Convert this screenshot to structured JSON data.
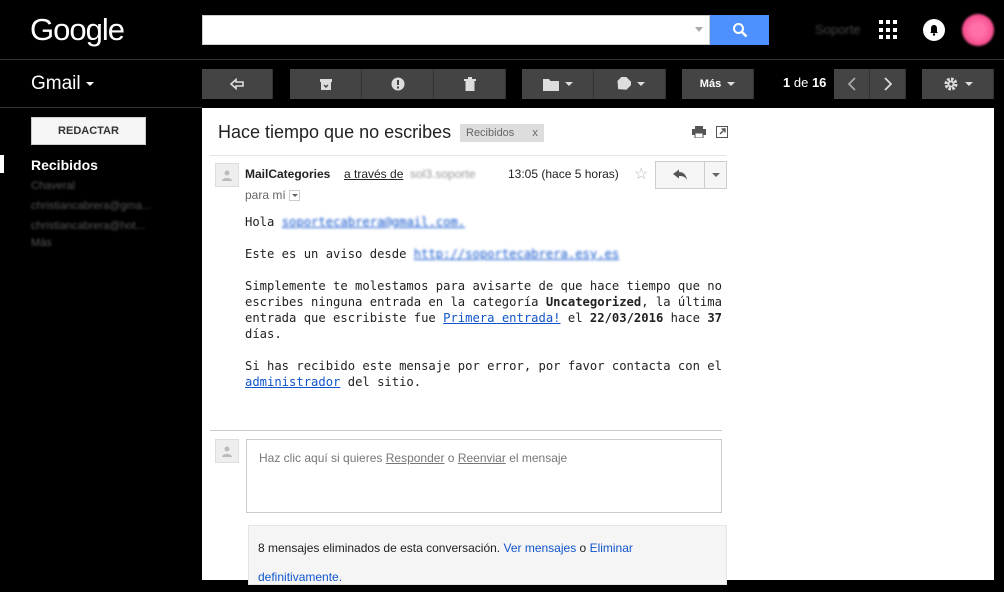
{
  "header": {
    "logo": "Google",
    "search": {
      "value": "",
      "placeholder": ""
    },
    "blurred_user": "Soporte",
    "apps_icon": "apps-grid-icon",
    "notifications_icon": "bell-icon"
  },
  "toolbar": {
    "app_name": "Gmail",
    "more_label": "Más",
    "pager": {
      "current": "1",
      "of_label": "de",
      "total": "16"
    }
  },
  "sidebar": {
    "compose_label": "REDACTAR",
    "inbox_label": "Recibidos",
    "blurred_items": [
      "Chaveral",
      "christiancabrera@gma...",
      "christiancabrera@hot...",
      "Más"
    ]
  },
  "email": {
    "subject": "Hace tiempo que no escribes",
    "label_chip": "Recibidos",
    "label_chip_close": "x",
    "sender": "MailCategories",
    "via_label": "a través de",
    "via_blurred": "sol3.soporte",
    "time": "13:05 (hace 5 horas)",
    "to_label": "para mí",
    "greeting": "Hola",
    "greeting_email": "soportecabrera@gmail.com.",
    "notice_prefix": "Este es un aviso desde",
    "notice_url": "http://soportecabrera.esy.es",
    "p1_line1": "Simplemente te molestamos para avisarte de que hace tiempo que no",
    "p1_line2_a": "escribes ninguna entrada en la categoría",
    "p1_category": "Uncategorized",
    "p1_line2_b": ", la última",
    "p1_line3_a": "entrada que escribiste fue",
    "p1_post_link": "Primera entrada!",
    "p1_line3_b": "el",
    "p1_date": "22/03/2016",
    "p1_line3_c": "hace",
    "p1_days": "37",
    "p1_line4": "días.",
    "p2_line1": "Si has recibido este mensaje por error, por favor contacta con el",
    "p2_admin_link": "administrador",
    "p2_line2_b": "del sitio."
  },
  "reply": {
    "prefix": "Haz clic aquí si quieres",
    "reply_link": "Responder",
    "or": "o",
    "forward_link": "Reenviar",
    "suffix": "el mensaje"
  },
  "deleted": {
    "text": "8 mensajes eliminados de esta conversación.",
    "view_link": "Ver mensajes",
    "or": "o",
    "delete_link_1": "Eliminar",
    "delete_link_2": "definitivamente."
  }
}
